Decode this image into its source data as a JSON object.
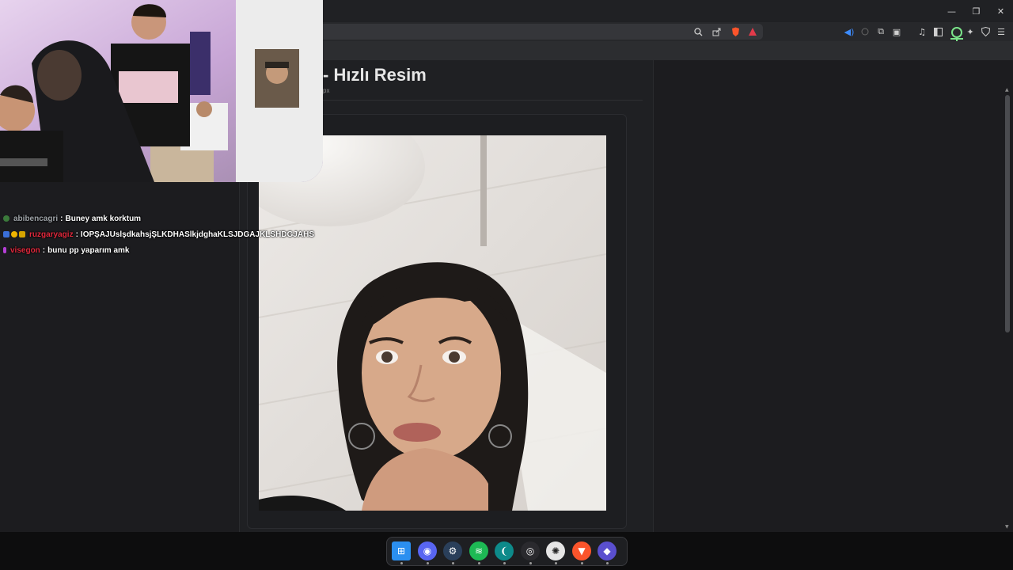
{
  "window": {
    "minimize_glyph": "—",
    "restore_glyph": "❐",
    "close_glyph": "✕"
  },
  "address_bar": {
    "icons": [
      "zoom-icon",
      "share-icon",
      "brave-shields-icon",
      "brave-rewards-icon"
    ]
  },
  "extensions": {
    "icons": [
      "audio-playing-icon",
      "extension-circle-icon",
      "puzzle-extensions-icon",
      "screenshot-icon",
      "music-icon",
      "sidebar-icon",
      "avatar-extension-icon",
      "sparkle-icon",
      "vpn-shield-icon",
      "menu-icon"
    ]
  },
  "page": {
    "title": "- Hızlı Resim",
    "subtitle": "px"
  },
  "chat": {
    "messages": [
      {
        "user": "abibencagri",
        "user_color": "#9ea3a8",
        "text": "Buney amk korktum",
        "badges": [
          "#3b7a3b"
        ]
      },
      {
        "user": "ruzgaryagiz",
        "user_color": "#e0283c",
        "text": "IOPŞAJUslşdkahsjŞLKDHASlkjdghaKLSJDGAJKLSHDGJAHS",
        "badges": [
          "#3a6fd8",
          "#f0b400",
          "#d6a400"
        ]
      },
      {
        "user": "visegon",
        "user_color": "#e0283c",
        "text": "bunu pp yaparım amk",
        "badges": [
          "#b43fd6"
        ]
      }
    ],
    "separator": ":"
  },
  "taskbar": {
    "apps": [
      {
        "name": "windows-start-icon",
        "color": "#2b8ff0",
        "glyph": "⊞"
      },
      {
        "name": "discord-icon",
        "color": "#5865f2",
        "glyph": "◉"
      },
      {
        "name": "steam-icon",
        "color": "#2a3f5a",
        "glyph": "⚙"
      },
      {
        "name": "spotify-icon",
        "color": "#1db954",
        "glyph": "≋"
      },
      {
        "name": "aura-app-icon",
        "color": "#0d8a8a",
        "glyph": "❨"
      },
      {
        "name": "obs-icon",
        "color": "#2a2a2e",
        "glyph": "◎"
      },
      {
        "name": "steelseries-icon",
        "color": "#e6e6e6",
        "glyph": "✺"
      },
      {
        "name": "brave-browser-icon",
        "color": "#fb542b",
        "glyph": "▼"
      },
      {
        "name": "linear-app-icon",
        "color": "#5a4fcf",
        "glyph": "◆"
      }
    ]
  }
}
